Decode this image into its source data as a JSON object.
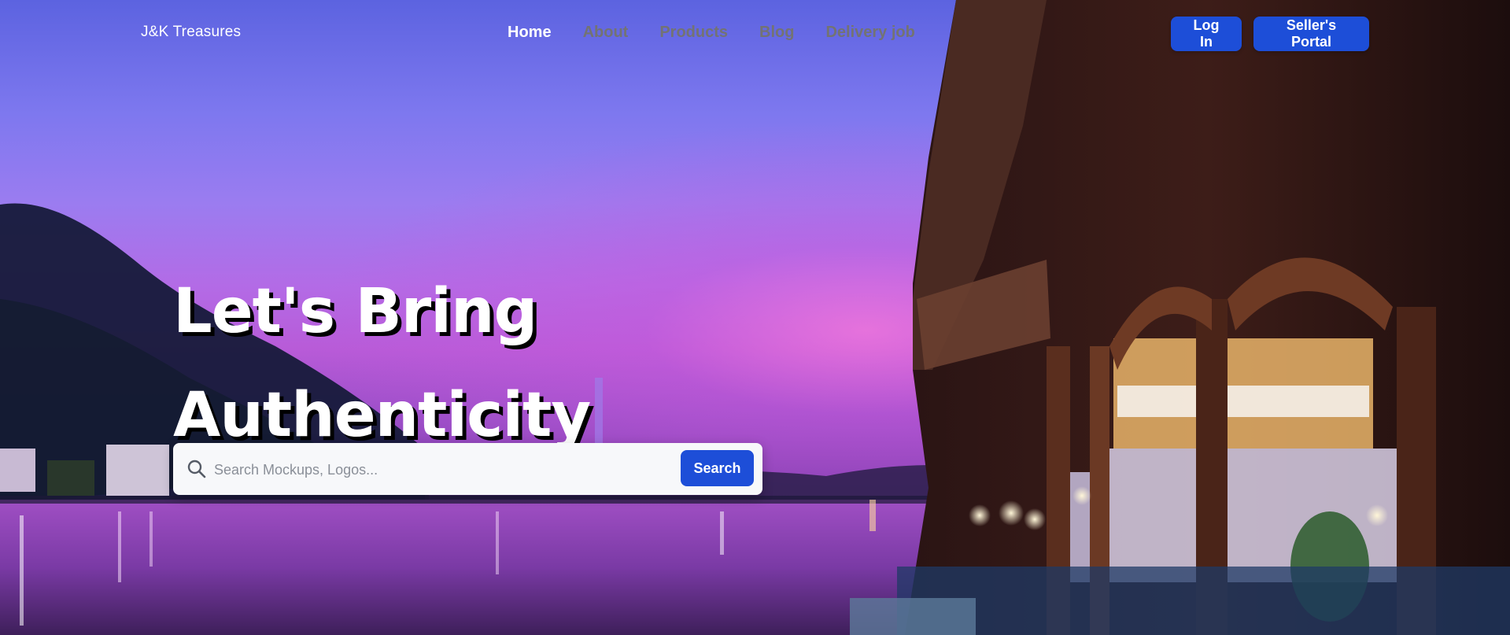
{
  "brand": {
    "name": "J&K Treasures"
  },
  "nav": {
    "items": [
      {
        "label": "Home",
        "active": true
      },
      {
        "label": "About",
        "active": false
      },
      {
        "label": "Products",
        "active": false
      },
      {
        "label": "Blog",
        "active": false
      },
      {
        "label": "Delivery job",
        "active": false
      }
    ],
    "login_label": "Log In",
    "seller_label": "Seller's Portal"
  },
  "hero": {
    "headline_line1": "Let's Bring",
    "headline_line2": "Authenticity"
  },
  "search": {
    "placeholder": "Search Mockups, Logos...",
    "value": "",
    "button_label": "Search",
    "icon": "search-icon"
  },
  "colors": {
    "accent": "#1d4ed8",
    "nav_inactive": "#737373",
    "nav_active": "#ffffff"
  }
}
